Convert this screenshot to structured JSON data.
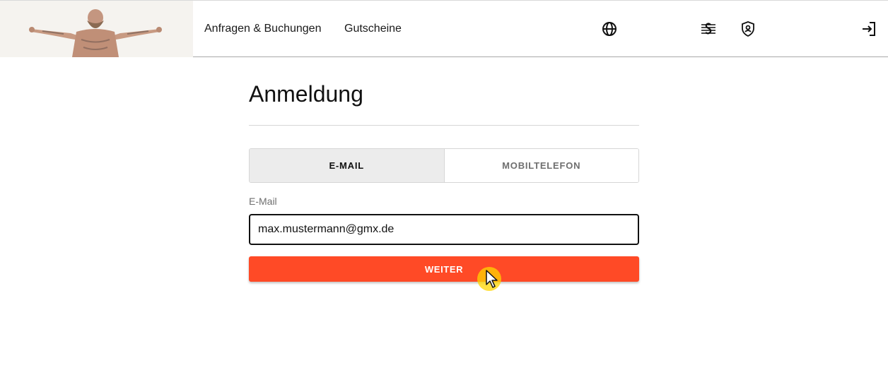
{
  "header": {
    "nav": [
      "Anfragen & Buchungen",
      "Gutscheine"
    ],
    "icons": [
      "globe-icon",
      "paragraph-law-icon",
      "shield-user-icon",
      "login-icon"
    ]
  },
  "main": {
    "title": "Anmeldung",
    "tabs": [
      {
        "label": "E-MAIL",
        "active": true
      },
      {
        "label": "MOBILTELEFON",
        "active": false
      }
    ],
    "email_label": "E-Mail",
    "email_value": "max.mustermann@gmx.de",
    "submit_label": "WEITER"
  },
  "colors": {
    "accent": "#ff4a26",
    "tab_active_bg": "#ececec",
    "cursor_highlight": "#ffd600"
  }
}
